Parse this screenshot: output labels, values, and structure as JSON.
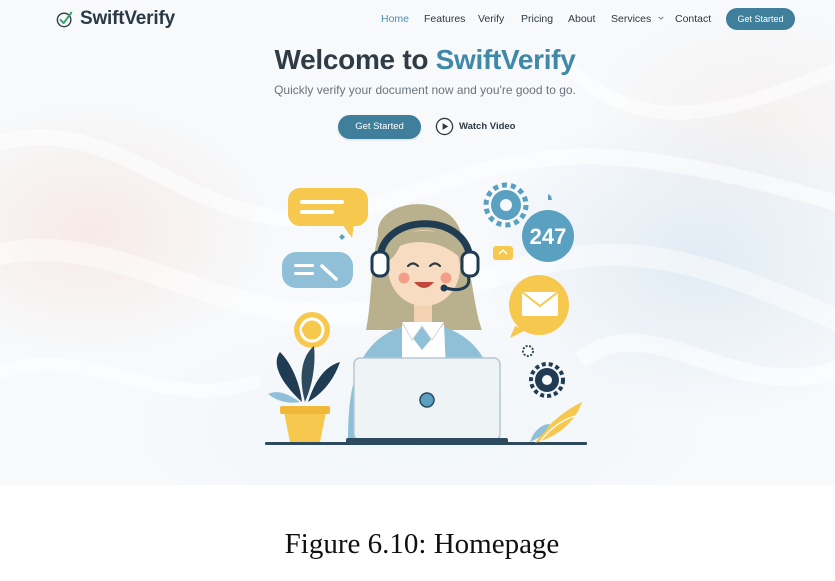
{
  "brand": {
    "name": "SwiftVerify",
    "logo_icon": "checkmark-badge-icon"
  },
  "nav": {
    "items": [
      {
        "label": "Home",
        "active": true
      },
      {
        "label": "Features"
      },
      {
        "label": "Verify"
      },
      {
        "label": "Pricing"
      },
      {
        "label": "About"
      },
      {
        "label": "Services",
        "dropdown": true
      },
      {
        "label": "Contact"
      }
    ],
    "cta_label": "Get Started"
  },
  "hero": {
    "title_prefix": "Welcome to ",
    "title_accent": "SwiftVerify",
    "subtitle": "Quickly verify your document now and you're good to go.",
    "cta_label": "Get Started",
    "watch_label": "Watch Video",
    "illustration": {
      "badge_text": "247"
    }
  },
  "caption": {
    "text": "Figure 6.10: Homepage"
  },
  "colors": {
    "accent": "#3f88a8",
    "button": "#3f7f9b",
    "text_dark": "#2f3b45",
    "yellow": "#f6c84e",
    "blue_light": "#8fc0d8"
  }
}
